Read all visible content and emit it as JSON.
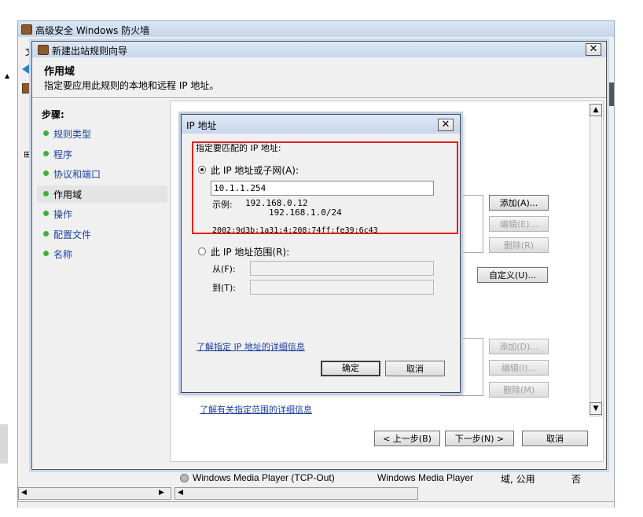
{
  "outer_window": {
    "title": "高级安全 Windows 防火墙",
    "menu_letter": "文",
    "tree_expand": "⊞"
  },
  "wizard": {
    "title": "新建出站规则向导",
    "close": "✕",
    "heading": "作用域",
    "description": "指定要应用此规则的本地和远程 IP 地址。",
    "steps_label": "步骤:",
    "steps": [
      "规则类型",
      "程序",
      "协议和端口",
      "作用域",
      "操作",
      "配置文件",
      "名称"
    ],
    "active_step": 3,
    "buttons_local": {
      "add": "添加(A)...",
      "edit": "编辑(E)...",
      "remove": "删除(R)"
    },
    "customize": "自定义(U)...",
    "buttons_remote": {
      "add": "添加(D)...",
      "edit": "编辑(I)...",
      "remove": "删除(M)"
    },
    "learn_more_link": "了解有关指定范围的详细信息",
    "back": "< 上一步(B)",
    "next": "下一步(N) >",
    "cancel": "取消"
  },
  "ip_dialog": {
    "title": "IP 地址",
    "close": "✕",
    "prompt": "指定要匹配的 IP 地址:",
    "option_single": "此 IP 地址或子网(A):",
    "ip_value": "10.1.1.254",
    "example_label": "示例:",
    "example_1": "192.168.0.12",
    "example_2": "192.168.1.0/24",
    "example_ipv6": "2002:9d3b:1a31:4:208:74ff:fe39:6c43",
    "option_range": "此 IP 地址范围(R):",
    "from_label": "从(F):",
    "to_label": "到(T):",
    "link": "了解指定 IP 地址的详细信息",
    "ok": "确定",
    "cancel": "取消"
  },
  "background_row": {
    "name": "Windows Media Player (TCP-Out)",
    "group": "Windows Media Player",
    "profile": "域, 公用",
    "enabled": "否"
  },
  "colors": {
    "highlight": "#e02020",
    "titlebar": "#c9d9ee",
    "link": "#1a3f9e",
    "step_dot": "#3bb33b"
  }
}
